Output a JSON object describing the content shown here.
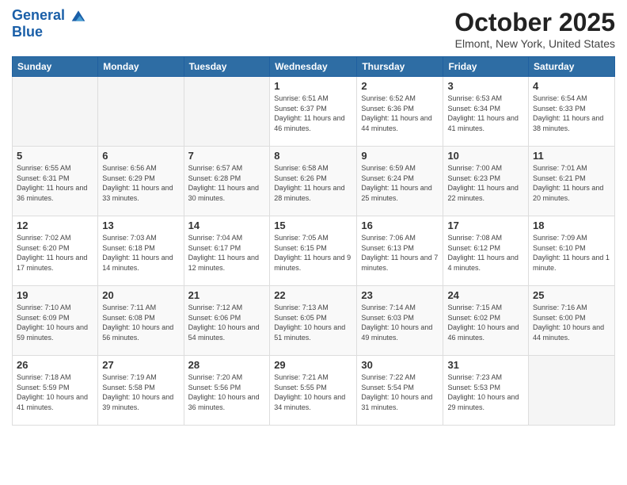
{
  "header": {
    "logo_line1": "General",
    "logo_line2": "Blue",
    "month": "October 2025",
    "location": "Elmont, New York, United States"
  },
  "weekdays": [
    "Sunday",
    "Monday",
    "Tuesday",
    "Wednesday",
    "Thursday",
    "Friday",
    "Saturday"
  ],
  "weeks": [
    [
      {
        "day": "",
        "sunrise": "",
        "sunset": "",
        "daylight": ""
      },
      {
        "day": "",
        "sunrise": "",
        "sunset": "",
        "daylight": ""
      },
      {
        "day": "",
        "sunrise": "",
        "sunset": "",
        "daylight": ""
      },
      {
        "day": "1",
        "sunrise": "Sunrise: 6:51 AM",
        "sunset": "Sunset: 6:37 PM",
        "daylight": "Daylight: 11 hours and 46 minutes."
      },
      {
        "day": "2",
        "sunrise": "Sunrise: 6:52 AM",
        "sunset": "Sunset: 6:36 PM",
        "daylight": "Daylight: 11 hours and 44 minutes."
      },
      {
        "day": "3",
        "sunrise": "Sunrise: 6:53 AM",
        "sunset": "Sunset: 6:34 PM",
        "daylight": "Daylight: 11 hours and 41 minutes."
      },
      {
        "day": "4",
        "sunrise": "Sunrise: 6:54 AM",
        "sunset": "Sunset: 6:33 PM",
        "daylight": "Daylight: 11 hours and 38 minutes."
      }
    ],
    [
      {
        "day": "5",
        "sunrise": "Sunrise: 6:55 AM",
        "sunset": "Sunset: 6:31 PM",
        "daylight": "Daylight: 11 hours and 36 minutes."
      },
      {
        "day": "6",
        "sunrise": "Sunrise: 6:56 AM",
        "sunset": "Sunset: 6:29 PM",
        "daylight": "Daylight: 11 hours and 33 minutes."
      },
      {
        "day": "7",
        "sunrise": "Sunrise: 6:57 AM",
        "sunset": "Sunset: 6:28 PM",
        "daylight": "Daylight: 11 hours and 30 minutes."
      },
      {
        "day": "8",
        "sunrise": "Sunrise: 6:58 AM",
        "sunset": "Sunset: 6:26 PM",
        "daylight": "Daylight: 11 hours and 28 minutes."
      },
      {
        "day": "9",
        "sunrise": "Sunrise: 6:59 AM",
        "sunset": "Sunset: 6:24 PM",
        "daylight": "Daylight: 11 hours and 25 minutes."
      },
      {
        "day": "10",
        "sunrise": "Sunrise: 7:00 AM",
        "sunset": "Sunset: 6:23 PM",
        "daylight": "Daylight: 11 hours and 22 minutes."
      },
      {
        "day": "11",
        "sunrise": "Sunrise: 7:01 AM",
        "sunset": "Sunset: 6:21 PM",
        "daylight": "Daylight: 11 hours and 20 minutes."
      }
    ],
    [
      {
        "day": "12",
        "sunrise": "Sunrise: 7:02 AM",
        "sunset": "Sunset: 6:20 PM",
        "daylight": "Daylight: 11 hours and 17 minutes."
      },
      {
        "day": "13",
        "sunrise": "Sunrise: 7:03 AM",
        "sunset": "Sunset: 6:18 PM",
        "daylight": "Daylight: 11 hours and 14 minutes."
      },
      {
        "day": "14",
        "sunrise": "Sunrise: 7:04 AM",
        "sunset": "Sunset: 6:17 PM",
        "daylight": "Daylight: 11 hours and 12 minutes."
      },
      {
        "day": "15",
        "sunrise": "Sunrise: 7:05 AM",
        "sunset": "Sunset: 6:15 PM",
        "daylight": "Daylight: 11 hours and 9 minutes."
      },
      {
        "day": "16",
        "sunrise": "Sunrise: 7:06 AM",
        "sunset": "Sunset: 6:13 PM",
        "daylight": "Daylight: 11 hours and 7 minutes."
      },
      {
        "day": "17",
        "sunrise": "Sunrise: 7:08 AM",
        "sunset": "Sunset: 6:12 PM",
        "daylight": "Daylight: 11 hours and 4 minutes."
      },
      {
        "day": "18",
        "sunrise": "Sunrise: 7:09 AM",
        "sunset": "Sunset: 6:10 PM",
        "daylight": "Daylight: 11 hours and 1 minute."
      }
    ],
    [
      {
        "day": "19",
        "sunrise": "Sunrise: 7:10 AM",
        "sunset": "Sunset: 6:09 PM",
        "daylight": "Daylight: 10 hours and 59 minutes."
      },
      {
        "day": "20",
        "sunrise": "Sunrise: 7:11 AM",
        "sunset": "Sunset: 6:08 PM",
        "daylight": "Daylight: 10 hours and 56 minutes."
      },
      {
        "day": "21",
        "sunrise": "Sunrise: 7:12 AM",
        "sunset": "Sunset: 6:06 PM",
        "daylight": "Daylight: 10 hours and 54 minutes."
      },
      {
        "day": "22",
        "sunrise": "Sunrise: 7:13 AM",
        "sunset": "Sunset: 6:05 PM",
        "daylight": "Daylight: 10 hours and 51 minutes."
      },
      {
        "day": "23",
        "sunrise": "Sunrise: 7:14 AM",
        "sunset": "Sunset: 6:03 PM",
        "daylight": "Daylight: 10 hours and 49 minutes."
      },
      {
        "day": "24",
        "sunrise": "Sunrise: 7:15 AM",
        "sunset": "Sunset: 6:02 PM",
        "daylight": "Daylight: 10 hours and 46 minutes."
      },
      {
        "day": "25",
        "sunrise": "Sunrise: 7:16 AM",
        "sunset": "Sunset: 6:00 PM",
        "daylight": "Daylight: 10 hours and 44 minutes."
      }
    ],
    [
      {
        "day": "26",
        "sunrise": "Sunrise: 7:18 AM",
        "sunset": "Sunset: 5:59 PM",
        "daylight": "Daylight: 10 hours and 41 minutes."
      },
      {
        "day": "27",
        "sunrise": "Sunrise: 7:19 AM",
        "sunset": "Sunset: 5:58 PM",
        "daylight": "Daylight: 10 hours and 39 minutes."
      },
      {
        "day": "28",
        "sunrise": "Sunrise: 7:20 AM",
        "sunset": "Sunset: 5:56 PM",
        "daylight": "Daylight: 10 hours and 36 minutes."
      },
      {
        "day": "29",
        "sunrise": "Sunrise: 7:21 AM",
        "sunset": "Sunset: 5:55 PM",
        "daylight": "Daylight: 10 hours and 34 minutes."
      },
      {
        "day": "30",
        "sunrise": "Sunrise: 7:22 AM",
        "sunset": "Sunset: 5:54 PM",
        "daylight": "Daylight: 10 hours and 31 minutes."
      },
      {
        "day": "31",
        "sunrise": "Sunrise: 7:23 AM",
        "sunset": "Sunset: 5:53 PM",
        "daylight": "Daylight: 10 hours and 29 minutes."
      },
      {
        "day": "",
        "sunrise": "",
        "sunset": "",
        "daylight": ""
      }
    ]
  ]
}
